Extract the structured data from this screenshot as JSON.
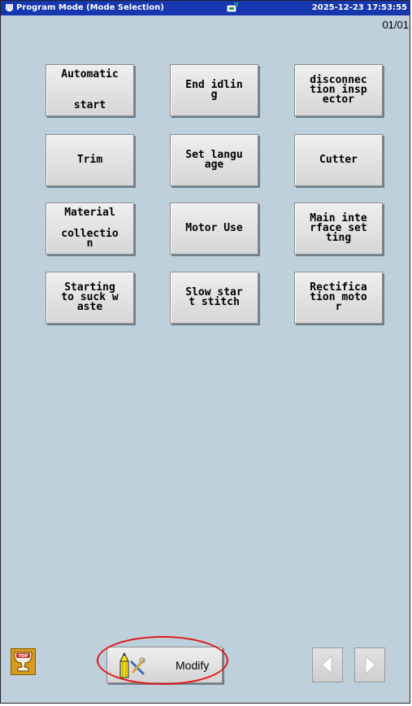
{
  "titlebar": {
    "title": "Program Mode (Mode Selection)",
    "clock": "2025-12-23 17:53:55",
    "app_icon": "monitor-icon",
    "status_icon": "network-status-icon"
  },
  "page_indicator": "01/01",
  "mode_buttons": [
    {
      "lines": [
        "Automatic",
        "start"
      ]
    },
    {
      "lines": [
        "End idlin",
        "g"
      ]
    },
    {
      "lines": [
        "disconnec",
        "tion insp",
        "ector"
      ]
    },
    {
      "lines": [
        "Trim"
      ]
    },
    {
      "lines": [
        "Set langu",
        "age"
      ]
    },
    {
      "lines": [
        "Cutter"
      ]
    },
    {
      "lines": [
        "Material",
        "collectio",
        "n"
      ]
    },
    {
      "lines": [
        "Motor Use"
      ]
    },
    {
      "lines": [
        "Main inte",
        "rface set",
        "ting"
      ]
    },
    {
      "lines": [
        "Starting",
        "to suck w",
        "aste"
      ]
    },
    {
      "lines": [
        "Slow star",
        "t stitch"
      ]
    },
    {
      "lines": [
        "Rectifica",
        "tion moto",
        "r"
      ]
    }
  ],
  "bottom": {
    "top_icon": "top-trophy-icon",
    "modify_label": "Modify",
    "modify_icon": "pencil-tools-icon",
    "prev_icon": "arrow-left-icon",
    "next_icon": "arrow-right-icon"
  },
  "colors": {
    "titlebar": "#1737b0",
    "background": "#bfd0dd",
    "highlight": "#e01818",
    "top_button": "#d79b1e"
  }
}
